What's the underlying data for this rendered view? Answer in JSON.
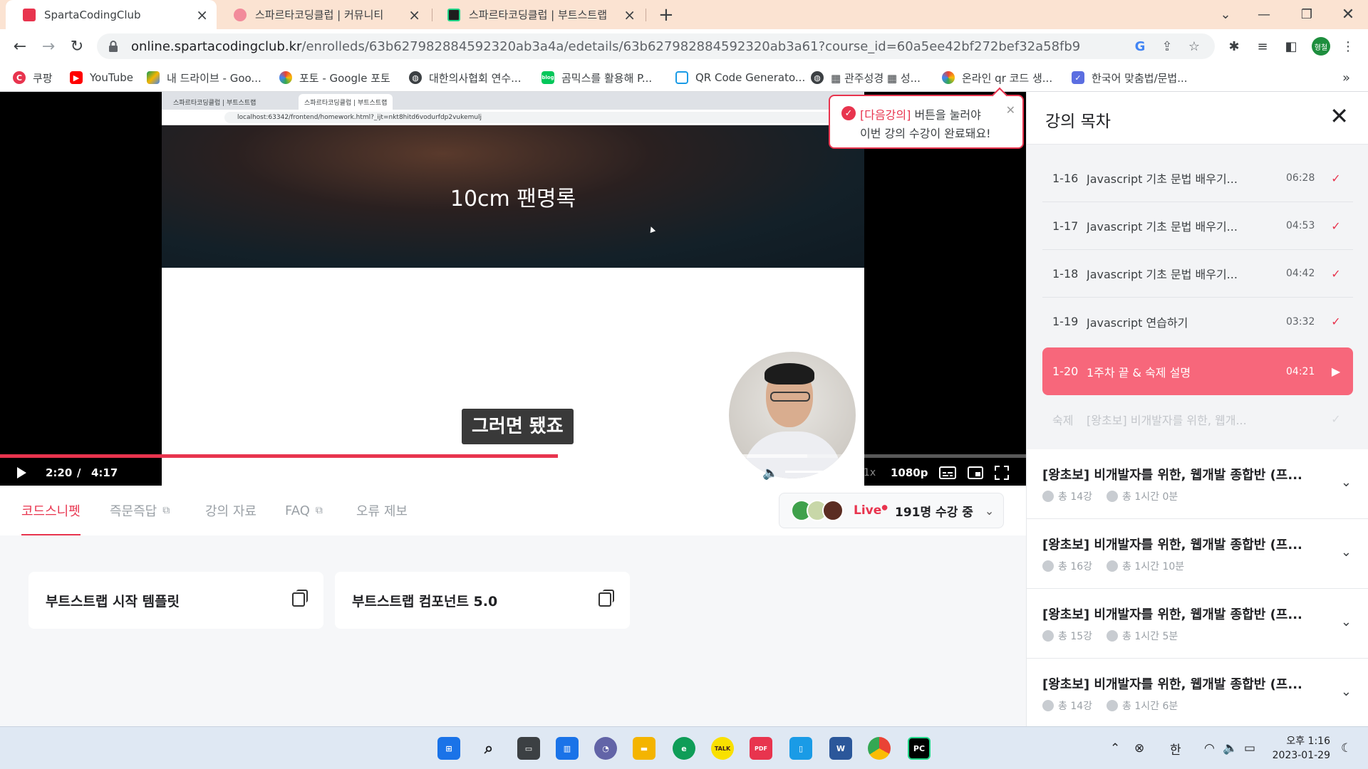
{
  "browser": {
    "tabs": [
      {
        "title": "SpartaCodingClub",
        "active": true
      },
      {
        "title": "스파르타코딩클럽 | 커뮤니티",
        "active": false
      },
      {
        "title": "스파르타코딩클럽 | 부트스트랩",
        "active": false
      }
    ],
    "url_host": "online.spartacodingclub.kr",
    "url_path": "/enrolleds/63b627982884592320ab3a4a/edetails/63b627982884592320ab3a61?course_id=60a5ee42bf272bef32a58fb9",
    "profile_label": "형철",
    "bookmarks": [
      {
        "label": "쿠팡",
        "color": "#e8344e",
        "icon": "coupang-icon"
      },
      {
        "label": "YouTube",
        "color": "#ff0000",
        "icon": "youtube-icon"
      },
      {
        "label": "내 드라이브 - Goo...",
        "color": "#f4b400",
        "icon": "drive-icon"
      },
      {
        "label": "포토 - Google 포토",
        "color": "#34a853",
        "icon": "photos-icon"
      },
      {
        "label": "대한의사협회 연수...",
        "color": "#3c4043",
        "icon": "globe-icon"
      },
      {
        "label": "곰믹스를 활용해 P...",
        "color": "#03c75a",
        "icon": "blog-icon"
      },
      {
        "label": "QR Code Generato...",
        "color": "#1a9be6",
        "icon": "qr-icon"
      },
      {
        "label": "▦ 관주성경 ▦ 성...",
        "color": "#3c4043",
        "icon": "globe-icon"
      },
      {
        "label": "온라인 qr 코드 생...",
        "color": "#ea4335",
        "icon": "flower-icon"
      },
      {
        "label": "한국어 맞춤법/문법...",
        "color": "#5b6ee1",
        "icon": "spell-icon"
      }
    ]
  },
  "video": {
    "inner_tabs": [
      "스파르타코딩클럽 | 부트스트랩",
      "스파르타코딩클럽 | 부트스트랩"
    ],
    "inner_url": "localhost:63342/frontend/homework.html?_ijt=nkt8hitd6vodurfdp2vukemulj",
    "hero_title": "10cm 팬명록",
    "subtitle": "그러면 됐죠",
    "current_time": "2:20",
    "separator": "/",
    "duration": "4:17",
    "progress": 0.544,
    "volume": 0.8,
    "speed": "1x",
    "quality": "1080p",
    "notice_line1_bracket": "[다음강의]",
    "notice_line1_rest": " 버튼을 눌러야",
    "notice_line2": "이번 강의 수강이 완료돼요!"
  },
  "subnav": {
    "tabs": [
      "코드스니펫",
      "즉문즉답",
      "강의 자료",
      "FAQ",
      "오류 제보"
    ],
    "live_label": "Live",
    "live_count": "191명 수강 중"
  },
  "snippets": [
    "부트스트랩 시작 템플릿",
    "부트스트랩 컴포넌트 5.0"
  ],
  "sidebar": {
    "title": "강의 목차",
    "lessons": [
      {
        "num": "1-16",
        "name": "Javascript 기초 문법 배우기...",
        "dur": "06:28",
        "state": "done"
      },
      {
        "num": "1-17",
        "name": "Javascript 기초 문법 배우기...",
        "dur": "04:53",
        "state": "done"
      },
      {
        "num": "1-18",
        "name": "Javascript 기초 문법 배우기...",
        "dur": "04:42",
        "state": "done"
      },
      {
        "num": "1-19",
        "name": "Javascript 연습하기",
        "dur": "03:32",
        "state": "done"
      },
      {
        "num": "1-20",
        "name": "1주차 끝 & 숙제 설명",
        "dur": "04:21",
        "state": "current"
      },
      {
        "num": "숙제",
        "name": "[왕초보] 비개발자를 위한, 웹개...",
        "dur": "",
        "state": "locked"
      }
    ],
    "weeks": [
      {
        "title": "[왕초보] 비개발자를 위한, 웹개발 종합반 (프...",
        "count": "총 14강",
        "time": "총 1시간 0분"
      },
      {
        "title": "[왕초보] 비개발자를 위한, 웹개발 종합반 (프...",
        "count": "총 16강",
        "time": "총 1시간 10분"
      },
      {
        "title": "[왕초보] 비개발자를 위한, 웹개발 종합반 (프...",
        "count": "총 15강",
        "time": "총 1시간 5분"
      },
      {
        "title": "[왕초보] 비개발자를 위한, 웹개발 종합반 (프...",
        "count": "총 14강",
        "time": "총 1시간 6분"
      }
    ]
  },
  "taskbar": {
    "ime": "한",
    "time": "오후 1:16",
    "date": "2023-01-29",
    "apps": [
      {
        "name": "windows-start-icon",
        "color": "#1a73e8"
      },
      {
        "name": "search-icon",
        "color": "#202124"
      },
      {
        "name": "task-view-icon",
        "color": "#3c4043"
      },
      {
        "name": "widgets-icon",
        "color": "#1a73e8"
      },
      {
        "name": "chat-icon",
        "color": "#6264a7"
      },
      {
        "name": "file-explorer-icon",
        "color": "#f4b400"
      },
      {
        "name": "edge-icon",
        "color": "#0f9d58"
      },
      {
        "name": "kakaotalk-icon",
        "color": "#f9e000"
      },
      {
        "name": "pdf-icon",
        "color": "#e8344e"
      },
      {
        "name": "notes-icon",
        "color": "#1a9be6"
      },
      {
        "name": "word-icon",
        "color": "#2b579a"
      },
      {
        "name": "chrome-icon",
        "color": "#34a853"
      },
      {
        "name": "pycharm-icon",
        "color": "#000000"
      }
    ]
  },
  "colors": {
    "accent": "#e8344e",
    "current_lesson": "#f7677b"
  }
}
